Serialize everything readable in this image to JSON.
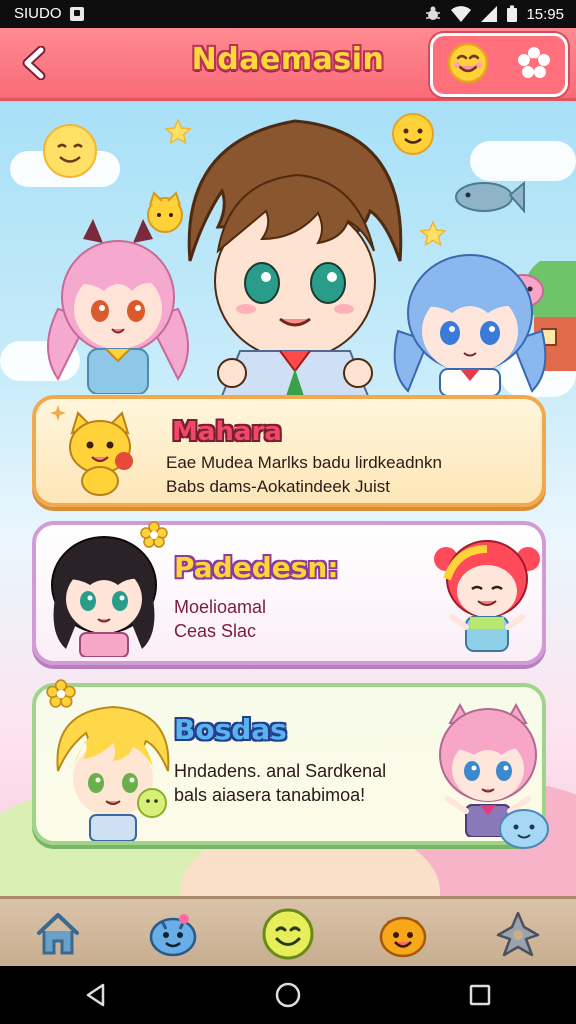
{
  "status_bar": {
    "left_label": "SIUDO",
    "time": "15:95",
    "icons": [
      "gallery-icon",
      "bug-icon",
      "wifi-icon",
      "signal-icon",
      "battery-icon"
    ]
  },
  "app_bar": {
    "title": "Ndaemasin",
    "back_icon": "chevron-left-icon",
    "right_icons": [
      "smiley-icon",
      "flower-settings-icon"
    ]
  },
  "cards": [
    {
      "title": "Mahara",
      "lines": [
        "Eae Mudea Marlks badu lirdkeadnkn",
        "Babs dams-Aokatindeek Juist"
      ],
      "character": "yellow-cat-mascot",
      "accent": "#f2a94d"
    },
    {
      "title": "Padedesn:",
      "lines": [
        "Moelioamal",
        "Ceas Slac"
      ],
      "character_left": "black-hair-girl",
      "character_right": "red-hair-girl",
      "accent": "#d39bd6"
    },
    {
      "title": "Bosdas",
      "lines": [
        "Hndadens. anal Sardkenal",
        "bals aiasera tanabimoa!"
      ],
      "character_left": "blonde-boy",
      "character_right": "pink-hair-girl",
      "accent": "#9fd48b"
    }
  ],
  "bottom_nav": [
    {
      "icon": "home-icon"
    },
    {
      "icon": "blue-monster-icon"
    },
    {
      "icon": "smiley-icon"
    },
    {
      "icon": "orange-monster-icon"
    },
    {
      "icon": "puzzle-icon"
    }
  ],
  "system_nav": [
    "back-triangle-icon",
    "home-circle-icon",
    "recents-square-icon"
  ],
  "colors": {
    "app_bar": "#f96b78",
    "title_fill": "#ffd83a",
    "title_stroke": "#b8315a",
    "nav_bar": "#c8ad8e"
  }
}
